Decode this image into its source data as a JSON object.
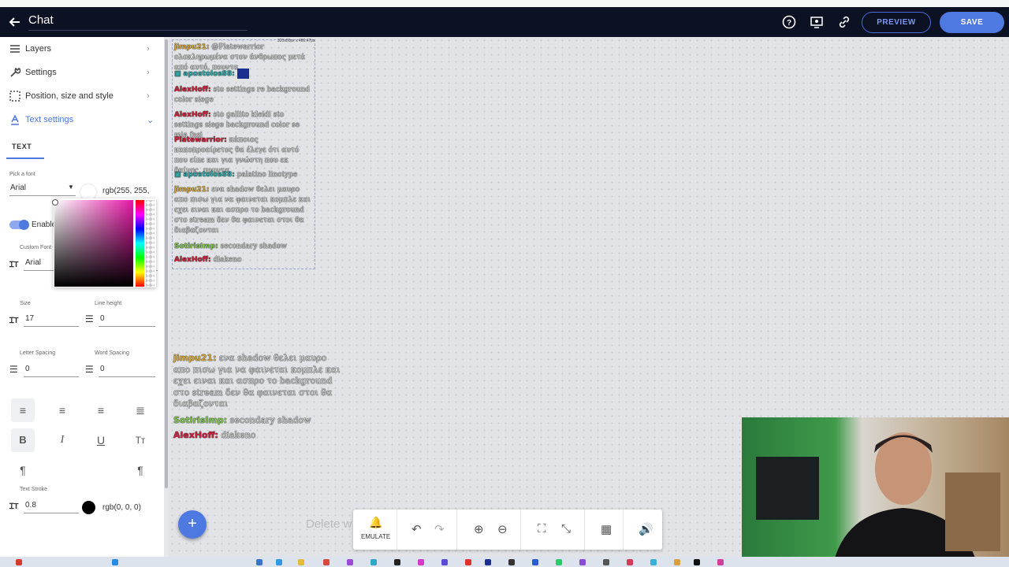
{
  "header": {
    "title": "Chat",
    "preview_label": "PREVIEW",
    "save_label": "SAVE"
  },
  "sidebar": {
    "menu": [
      {
        "label": "Layers",
        "icon": "layers-icon"
      },
      {
        "label": "Settings",
        "icon": "wrench-icon"
      },
      {
        "label": "Position, size and style",
        "icon": "selection-icon"
      },
      {
        "label": "Text settings",
        "icon": "text-icon"
      }
    ],
    "tab": "TEXT",
    "font_picker_label": "Pick a font",
    "font_value": "Arial",
    "color_value": "rgb(255, 255,",
    "enable_label": "Enable",
    "custom_font_label": "Custom Font",
    "custom_font_value": "Arial",
    "size_label": "Size",
    "size_value": "17",
    "line_height_label": "Line height",
    "line_height_value": "0",
    "letter_spacing_label": "Letter Spacing",
    "letter_spacing_value": "0",
    "word_spacing_label": "Word Spacing",
    "word_spacing_value": "0",
    "text_stroke_label": "Text Stroke",
    "text_stroke_value": "0.8",
    "stroke_color_value": "rgb(0, 0, 0)",
    "accent_color": "#4d79e0"
  },
  "canvas": {
    "widget_dims": "320x00px x 486.47px",
    "chat_messages": [
      {
        "user": "jimpu21:",
        "text": "@Platewarrior ολοκληρωμένα στον άνθρωπος μετά από αυτό, πουντα"
      },
      {
        "user": "apostolos88:",
        "text": ""
      },
      {
        "user": "AlexHoff:",
        "text": "sto settings re background color siege"
      },
      {
        "user": "AlexHoff:",
        "text": "sto gallito kleidi sto settings siege background color se mia fasi"
      },
      {
        "user": "Platewarrior:",
        "text": "κάποιος κακοπροαίρετος θα έλεγε ότι αυτό που είπε και για γνώστη που εκ δαίνης, πουντα"
      },
      {
        "user": "apostolos88:",
        "text": "palatino linotype"
      },
      {
        "user": "jimpu21:",
        "text": "ενα shadow θελει μαυρο απο πισω για να φαινεται κομπλε και εχει ειναι και ασπρο το background στο stream δεν θα φαινεται στοι θα διαβαζονται"
      },
      {
        "user": "SotirisImp:",
        "text": "secondary shadow"
      },
      {
        "user": "AlexHoff:",
        "text": "diakeno"
      }
    ],
    "preview_messages": [
      {
        "user": "jimpu21:",
        "text": "ενα shadow θελει μαυρο απο πισω για να φαινεται κομπλε και εχει ειναι και ασπρο το background στο stream δεν θα φαινεται στοι θα διαβαζονται"
      },
      {
        "user": "SotirisImp:",
        "text": "secondary shadow"
      },
      {
        "user": "AlexHoff:",
        "text": "diakeno"
      }
    ],
    "ghost_text": "Delete w"
  },
  "toolbar": {
    "emulate_label": "EMULATE"
  }
}
